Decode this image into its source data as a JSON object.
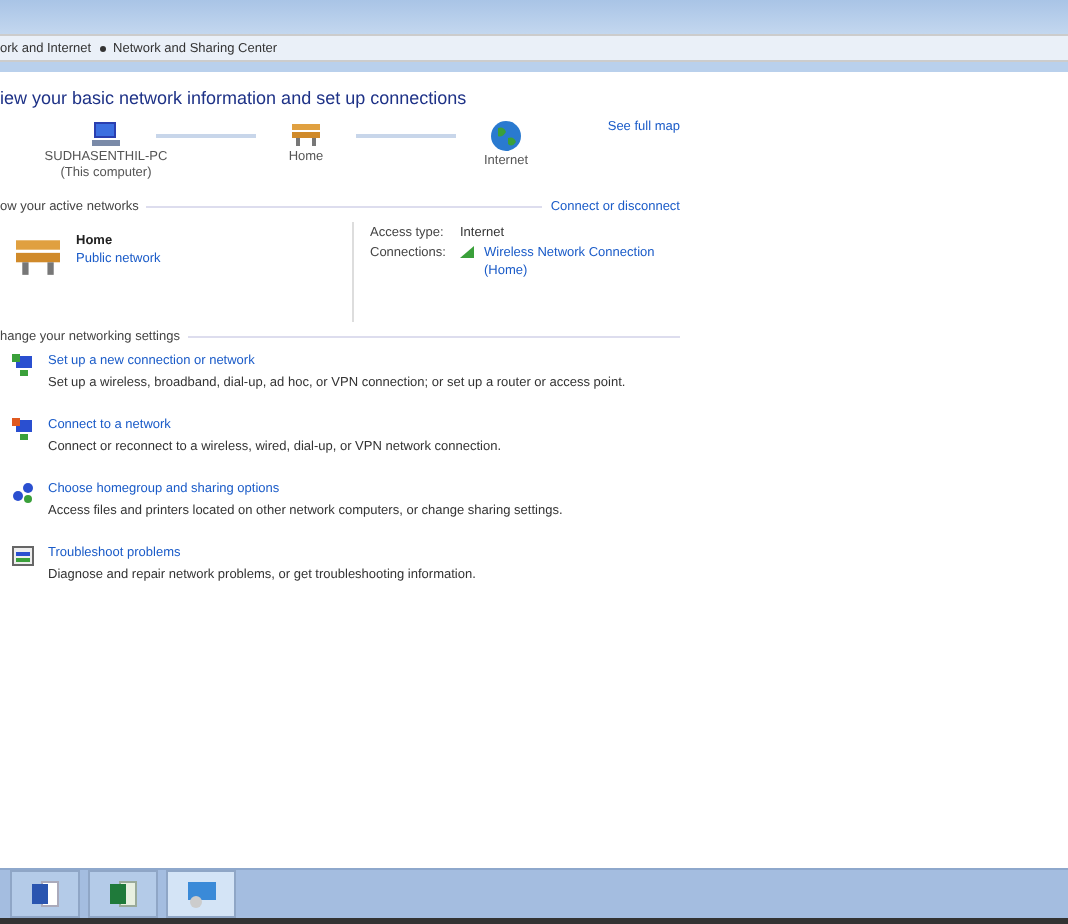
{
  "breadcrumb": [
    {
      "label": "ork and Internet"
    },
    {
      "label": "Network and Sharing Center"
    }
  ],
  "heading": "iew your basic network information and set up connections",
  "network_map": {
    "nodes": [
      {
        "kind": "computer",
        "label": "SUDHASENTHIL-PC",
        "sublabel": "(This computer)"
      },
      {
        "kind": "bench",
        "label": "Home"
      },
      {
        "kind": "globe",
        "label": "Internet"
      }
    ],
    "link": "See full map"
  },
  "active_networks": {
    "header": "ow your active networks",
    "link": "Connect or disconnect",
    "name": "Home",
    "type_link": "Public network",
    "access_type_label": "Access type:",
    "access_type": "Internet",
    "connections_label": "Connections:",
    "connection": "Wireless Network Connection",
    "connection_sub": "(Home)"
  },
  "settings": {
    "header": "hange your networking settings",
    "tasks": [
      {
        "kind": "new-connection",
        "link": "Set up a new connection or network",
        "description": "Set up a wireless, broadband, dial-up, ad hoc, or VPN connection; or set up a router or access point."
      },
      {
        "kind": "connect",
        "link": "Connect to a network",
        "description": "Connect or reconnect to a wireless, wired, dial-up, or VPN network connection."
      },
      {
        "kind": "homegroup",
        "link": "Choose homegroup and sharing options",
        "description": "Access files and printers located on other network computers, or change sharing settings."
      },
      {
        "kind": "troubleshoot",
        "link": "Troubleshoot problems",
        "description": "Diagnose and repair network problems, or get troubleshooting information."
      }
    ]
  },
  "taskbar": [
    {
      "kind": "word",
      "selected": false
    },
    {
      "kind": "excel",
      "selected": false
    },
    {
      "kind": "network",
      "selected": true
    }
  ]
}
